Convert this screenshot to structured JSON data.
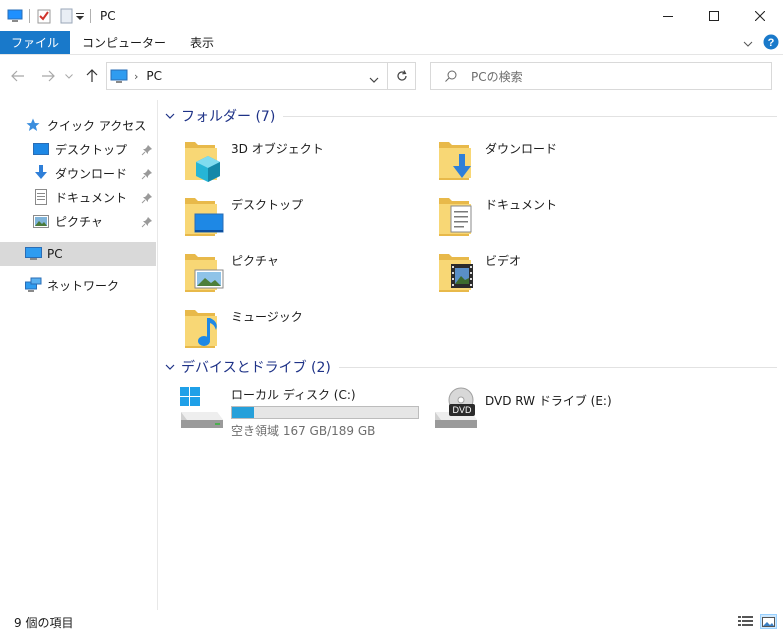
{
  "window": {
    "title": "PC"
  },
  "ribbon": {
    "tabs": [
      "ファイル",
      "コンピューター",
      "表示"
    ]
  },
  "address": {
    "location": "PC",
    "search_placeholder": "PCの検索"
  },
  "nav": {
    "quick_access": "クイック アクセス",
    "pinned": [
      "デスクトップ",
      "ダウンロード",
      "ドキュメント",
      "ピクチャ"
    ],
    "pc": "PC",
    "network": "ネットワーク"
  },
  "folders": {
    "header": "フォルダー (7)",
    "items": [
      "3D オブジェクト",
      "ダウンロード",
      "デスクトップ",
      "ドキュメント",
      "ピクチャ",
      "ビデオ",
      "ミュージック"
    ]
  },
  "drives": {
    "header": "デバイスとドライブ (2)",
    "local": {
      "name": "ローカル ディスク (C:)",
      "free_text": "空き領域 167 GB/189 GB",
      "used_fraction": 0.116
    },
    "dvd": {
      "name": "DVD RW ドライブ (E:)",
      "label": "DVD"
    }
  },
  "status": {
    "item_count": "9 個の項目"
  },
  "colors": {
    "accent": "#1979ca",
    "group_header": "#1e3287",
    "progress": "#26a0da",
    "folder_yellow": "#f8d775",
    "selected": "#d9d9d9"
  }
}
